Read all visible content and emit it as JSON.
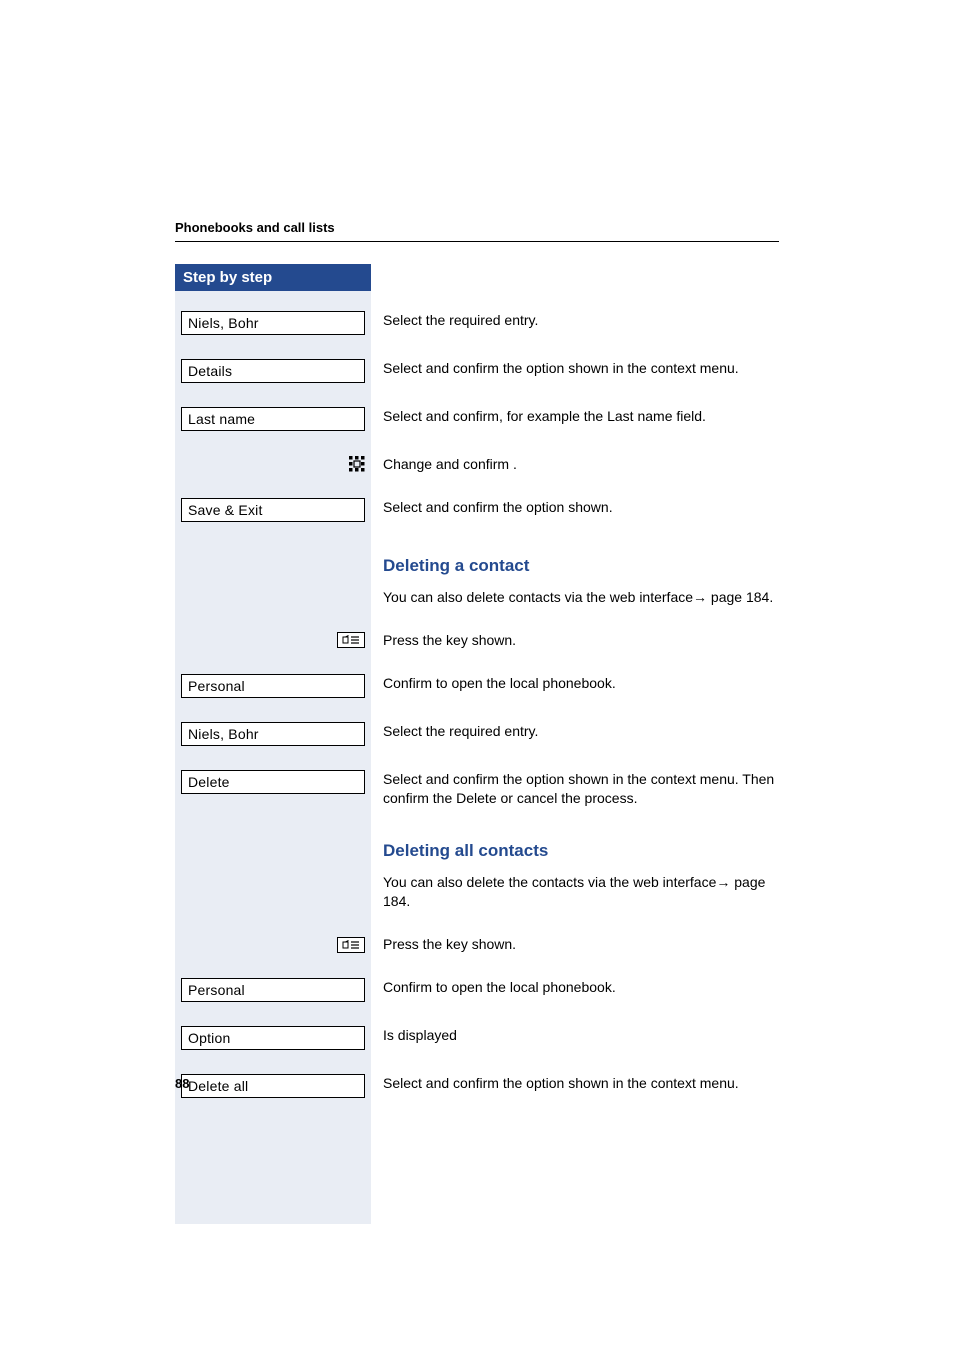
{
  "header": {
    "section_title": "Phonebooks and call lists"
  },
  "sidebar": {
    "title": "Step by step"
  },
  "rows": [
    {
      "box": "Niels, Bohr",
      "desc": "Select the required entry."
    },
    {
      "box": "Details",
      "desc": "Select and confirm the option shown in the context menu."
    },
    {
      "box": "Last name",
      "desc": "Select and confirm, for example the Last name field."
    },
    {
      "icon": "keypad",
      "desc": "Change and confirm ."
    },
    {
      "box": "Save & Exit",
      "desc": "Select and confirm the option shown."
    }
  ],
  "section_delete_contact": {
    "heading": "Deleting a contact",
    "intro_a": "You can also delete contacts via the web interface",
    "intro_b": " page 184.",
    "rows": [
      {
        "icon": "key",
        "desc": "Press the key shown."
      },
      {
        "box": "Personal",
        "desc": "Confirm to open the local phonebook."
      },
      {
        "box": "Niels, Bohr",
        "desc": "Select the required entry."
      },
      {
        "box": "Delete",
        "desc": "Select and confirm the option shown in the context menu. Then confirm the Delete or cancel the process."
      }
    ]
  },
  "section_delete_all": {
    "heading": "Deleting all contacts",
    "intro_a": "You can also delete the contacts via the web interface",
    "intro_b": " page 184.",
    "rows": [
      {
        "icon": "key",
        "desc": "Press the key shown."
      },
      {
        "box": "Personal",
        "desc": "Confirm to open the local phonebook."
      },
      {
        "box": "Option",
        "desc": "Is displayed"
      },
      {
        "box": "Delete all",
        "desc": "Select and confirm the option shown in the context menu."
      }
    ]
  },
  "footer": {
    "page_number": "88"
  }
}
